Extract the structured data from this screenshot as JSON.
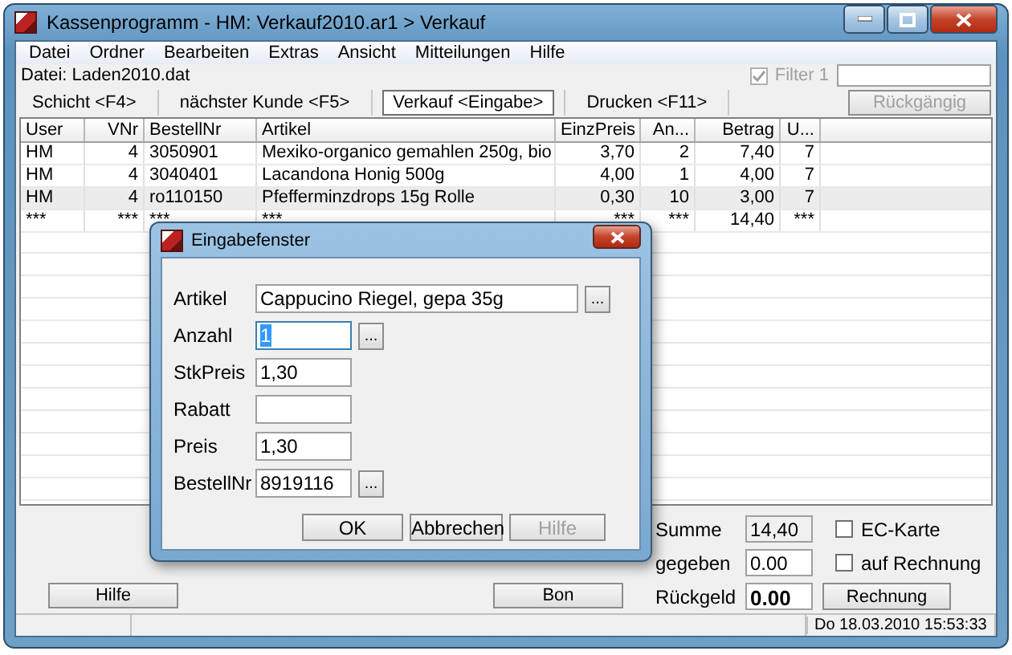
{
  "window": {
    "title": "Kassenprogramm - HM: Verkauf2010.ar1 > Verkauf"
  },
  "menu": [
    "Datei",
    "Ordner",
    "Bearbeiten",
    "Extras",
    "Ansicht",
    "Mitteilungen",
    "Hilfe"
  ],
  "file_label": "Datei: Laden2010.dat",
  "filter": {
    "label": "Filter 1",
    "checked": true,
    "disabled": true
  },
  "tabs": [
    {
      "label": "Schicht <F4>",
      "selected": false
    },
    {
      "label": "nächster Kunde <F5>",
      "selected": false
    },
    {
      "label": "Verkauf <Eingabe>",
      "selected": true
    },
    {
      "label": "Drucken <F11>",
      "selected": false
    }
  ],
  "undo_button": {
    "label": "Rückgängig",
    "disabled": true
  },
  "table": {
    "columns": [
      "User",
      "VNr",
      "BestellNr",
      "Artikel",
      "EinzPreis",
      "An...",
      "Betrag",
      "U..."
    ],
    "rows": [
      {
        "cells": [
          "HM",
          "4",
          "3050901",
          "Mexiko-organico gemahlen 250g, bio",
          "3,70",
          "2",
          "7,40",
          "7"
        ],
        "selected": false
      },
      {
        "cells": [
          "HM",
          "4",
          "3040401",
          "Lacandona Honig 500g",
          "4,00",
          "1",
          "4,00",
          "7"
        ],
        "selected": false
      },
      {
        "cells": [
          "HM",
          "4",
          "ro110150",
          "Pfefferminzdrops 15g Rolle",
          "0,30",
          "10",
          "3,00",
          "7"
        ],
        "selected": true
      },
      {
        "cells": [
          "***",
          "***",
          "***",
          "***",
          "***",
          "***",
          "14,40",
          "***"
        ],
        "selected": false
      }
    ]
  },
  "totals": [
    {
      "label": "Summe",
      "value": "14,40",
      "kind": "readonly"
    },
    {
      "label": "gegeben",
      "value": "0.00",
      "kind": "input"
    },
    {
      "label": "Rückgeld",
      "value": "0.00",
      "kind": "result"
    }
  ],
  "options": [
    {
      "label": "EC-Karte",
      "checked": false
    },
    {
      "label": "auf Rechnung",
      "checked": false
    }
  ],
  "help_button": "Hilfe",
  "bon_button": "Bon",
  "invoice_button": "Rechnung",
  "status_bar": {
    "datetime": "Do 18.03.2010 15:53:33"
  },
  "dialog": {
    "title": "Eingabefenster",
    "fields": [
      {
        "label": "Artikel",
        "value": "Cappucino Riegel, gepa 35g",
        "kind": "wide",
        "lookup": true,
        "text_selected": false
      },
      {
        "label": "Anzahl",
        "value": "1",
        "kind": "short",
        "lookup": true,
        "text_selected": true
      },
      {
        "label": "StkPreis",
        "value": "1,30",
        "kind": "short",
        "lookup": false,
        "text_selected": false
      },
      {
        "label": "Rabatt",
        "kind": "short",
        "lookup": false,
        "text_selected": false
      },
      {
        "label": "Preis",
        "value": "1,30",
        "kind": "short",
        "lookup": false,
        "text_selected": false
      },
      {
        "label": "BestellNr",
        "value": "8919116",
        "kind": "short",
        "lookup": true,
        "text_selected": false
      }
    ],
    "lookup_label": "...",
    "buttons": [
      {
        "label": "OK",
        "disabled": false
      },
      {
        "label": "Abbrechen",
        "disabled": false
      },
      {
        "label": "Hilfe",
        "disabled": true
      }
    ]
  }
}
